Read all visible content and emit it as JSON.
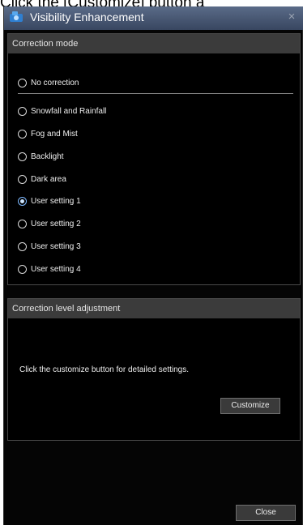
{
  "caption": {
    "text": "Click the [Customize] button a"
  },
  "window": {
    "title": "Visibility Enhancement",
    "close_glyph": "×",
    "icon": "camera-icon"
  },
  "correction_mode": {
    "header": "Correction mode",
    "options": [
      {
        "label": "No correction",
        "checked": false
      },
      {
        "label": "Snowfall and Rainfall",
        "checked": false
      },
      {
        "label": "Fog and Mist",
        "checked": false
      },
      {
        "label": "Backlight",
        "checked": false
      },
      {
        "label": "Dark area",
        "checked": false
      },
      {
        "label": "User setting 1",
        "checked": true
      },
      {
        "label": "User setting 2",
        "checked": false
      },
      {
        "label": "User setting 3",
        "checked": false
      },
      {
        "label": "User setting 4",
        "checked": false
      }
    ]
  },
  "correction_level": {
    "header": "Correction level adjustment",
    "hint": "Click the customize button  for detailed settings.",
    "customize_label": "Customize"
  },
  "footer": {
    "close_label": "Close"
  },
  "colors": {
    "window_bg": "#050505",
    "titlebar": "#4a5a78",
    "panel_header": "#3b3b3b",
    "selected_radio": "#7db8ff"
  }
}
